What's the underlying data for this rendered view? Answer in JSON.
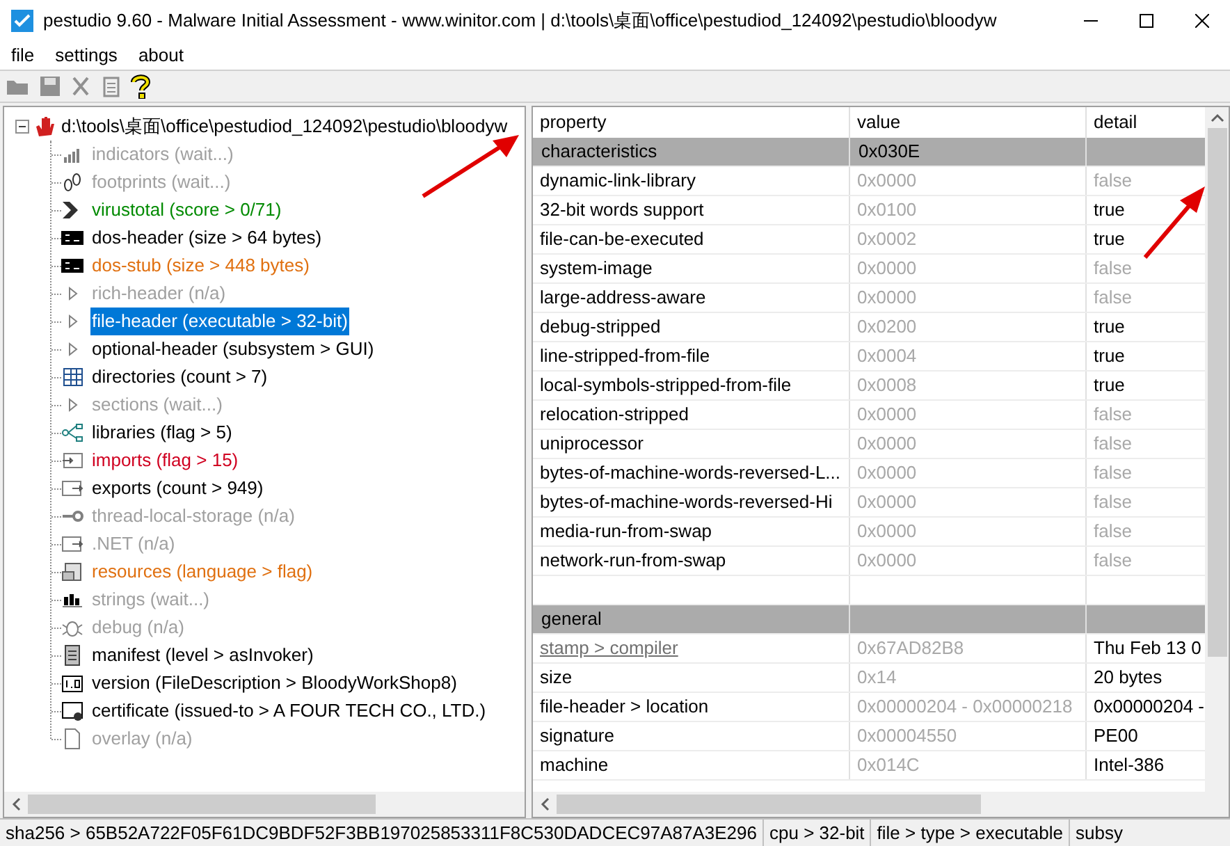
{
  "window": {
    "title": "pestudio 9.60 - Malware Initial Assessment - www.winitor.com | d:\\tools\\桌面\\office\\pestudiod_124092\\pestudio\\bloodyw"
  },
  "menu": [
    "file",
    "settings",
    "about"
  ],
  "tree": {
    "root": "d:\\tools\\桌面\\office\\pestudiod_124092\\pestudio\\bloodyw",
    "expanded": true,
    "children": [
      {
        "label": "indicators (wait...)",
        "kind": "chart",
        "color": "#a0a0a0",
        "selected": false
      },
      {
        "label": "footprints (wait...)",
        "kind": "footprint",
        "color": "#a0a0a0",
        "selected": false
      },
      {
        "label": "virustotal (score > 0/71)",
        "kind": "vt",
        "color": "#008a00",
        "selected": false
      },
      {
        "label": "dos-header (size > 64 bytes)",
        "kind": "console",
        "color": "#000000",
        "selected": false
      },
      {
        "label": "dos-stub (size > 448 bytes)",
        "kind": "console",
        "color": "#e07010",
        "selected": false
      },
      {
        "label": "rich-header (n/a)",
        "kind": "expander",
        "color": "#a0a0a0",
        "selected": false
      },
      {
        "label": "file-header (executable > 32-bit)",
        "kind": "expander",
        "selected": true
      },
      {
        "label": "optional-header (subsystem > GUI)",
        "kind": "expander",
        "color": "#000000",
        "selected": false
      },
      {
        "label": "directories (count > 7)",
        "kind": "grid",
        "color": "#000000",
        "selected": false
      },
      {
        "label": "sections (wait...)",
        "kind": "expander",
        "color": "#a0a0a0",
        "selected": false
      },
      {
        "label": "libraries (flag > 5)",
        "kind": "graph",
        "color": "#000000",
        "selected": false
      },
      {
        "label": "imports (flag > 15)",
        "kind": "import",
        "color": "#d00020",
        "selected": false
      },
      {
        "label": "exports (count > 949)",
        "kind": "export",
        "color": "#000000",
        "selected": false
      },
      {
        "label": "thread-local-storage (n/a)",
        "kind": "tls",
        "color": "#a0a0a0",
        "selected": false
      },
      {
        "label": ".NET (n/a)",
        "kind": "export",
        "color": "#a0a0a0",
        "selected": false
      },
      {
        "label": "resources (language > flag)",
        "kind": "resource",
        "color": "#e07010",
        "selected": false
      },
      {
        "label": "strings (wait...)",
        "kind": "text",
        "color": "#a0a0a0",
        "selected": false
      },
      {
        "label": "debug (n/a)",
        "kind": "bug",
        "color": "#a0a0a0",
        "selected": false
      },
      {
        "label": "manifest (level > asInvoker)",
        "kind": "manifest",
        "color": "#000000",
        "selected": false
      },
      {
        "label": "version (FileDescription > BloodyWorkShop8)",
        "kind": "version",
        "color": "#000000",
        "selected": false
      },
      {
        "label": "certificate (issued-to > A FOUR TECH CO., LTD.)",
        "kind": "certificate",
        "color": "#000000",
        "selected": false
      },
      {
        "label": "overlay (n/a)",
        "kind": "file",
        "color": "#a0a0a0",
        "selected": false
      }
    ]
  },
  "table": {
    "columns": [
      "property",
      "value",
      "detail"
    ],
    "rows": [
      {
        "kind": "section",
        "property": "characteristics",
        "value": "0x030E"
      },
      {
        "kind": "item",
        "property": "dynamic-link-library",
        "value": "0x0000",
        "detail": "false",
        "muted": true
      },
      {
        "kind": "item",
        "property": "32-bit words support",
        "value": "0x0100",
        "detail": "true",
        "muted": false
      },
      {
        "kind": "item",
        "property": "file-can-be-executed",
        "value": "0x0002",
        "detail": "true",
        "muted": false
      },
      {
        "kind": "item",
        "property": "system-image",
        "value": "0x0000",
        "detail": "false",
        "muted": true
      },
      {
        "kind": "item",
        "property": "large-address-aware",
        "value": "0x0000",
        "detail": "false",
        "muted": true
      },
      {
        "kind": "item",
        "property": "debug-stripped",
        "value": "0x0200",
        "detail": "true",
        "muted": false
      },
      {
        "kind": "item",
        "property": "line-stripped-from-file",
        "value": "0x0004",
        "detail": "true",
        "muted": false
      },
      {
        "kind": "item",
        "property": "local-symbols-stripped-from-file",
        "value": "0x0008",
        "detail": "true",
        "muted": false
      },
      {
        "kind": "item",
        "property": "relocation-stripped",
        "value": "0x0000",
        "detail": "false",
        "muted": true
      },
      {
        "kind": "item",
        "property": "uniprocessor",
        "value": "0x0000",
        "detail": "false",
        "muted": true
      },
      {
        "kind": "item",
        "property": "bytes-of-machine-words-reversed-L...",
        "value": "0x0000",
        "detail": "false",
        "muted": true
      },
      {
        "kind": "item",
        "property": "bytes-of-machine-words-reversed-Hi",
        "value": "0x0000",
        "detail": "false",
        "muted": true
      },
      {
        "kind": "item",
        "property": "media-run-from-swap",
        "value": "0x0000",
        "detail": "false",
        "muted": true
      },
      {
        "kind": "item",
        "property": "network-run-from-swap",
        "value": "0x0000",
        "detail": "false",
        "muted": true
      },
      {
        "kind": "blank"
      },
      {
        "kind": "section",
        "property": "general"
      },
      {
        "kind": "link",
        "property": "stamp > compiler",
        "value": "0x67AD82B8",
        "detail": "Thu Feb 13 0",
        "muted": false
      },
      {
        "kind": "item",
        "property": "size",
        "value": "0x14",
        "detail": "20 bytes",
        "muted": false
      },
      {
        "kind": "item",
        "property": "file-header > location",
        "value": "0x00000204 - 0x00000218",
        "detail": "0x00000204 -",
        "muted": false
      },
      {
        "kind": "item",
        "property": "signature",
        "value": "0x00004550",
        "detail": "PE00",
        "muted": false
      },
      {
        "kind": "item",
        "property": "machine",
        "value": "0x014C",
        "detail": "Intel-386",
        "muted": false
      }
    ]
  },
  "status_bar": [
    "sha256 > 65B52A722F05F61DC9BDF52F3BB197025853311F8C530DADCEC97A87A3E296",
    "cpu > 32-bit",
    "file > type > executable",
    "subsy"
  ]
}
